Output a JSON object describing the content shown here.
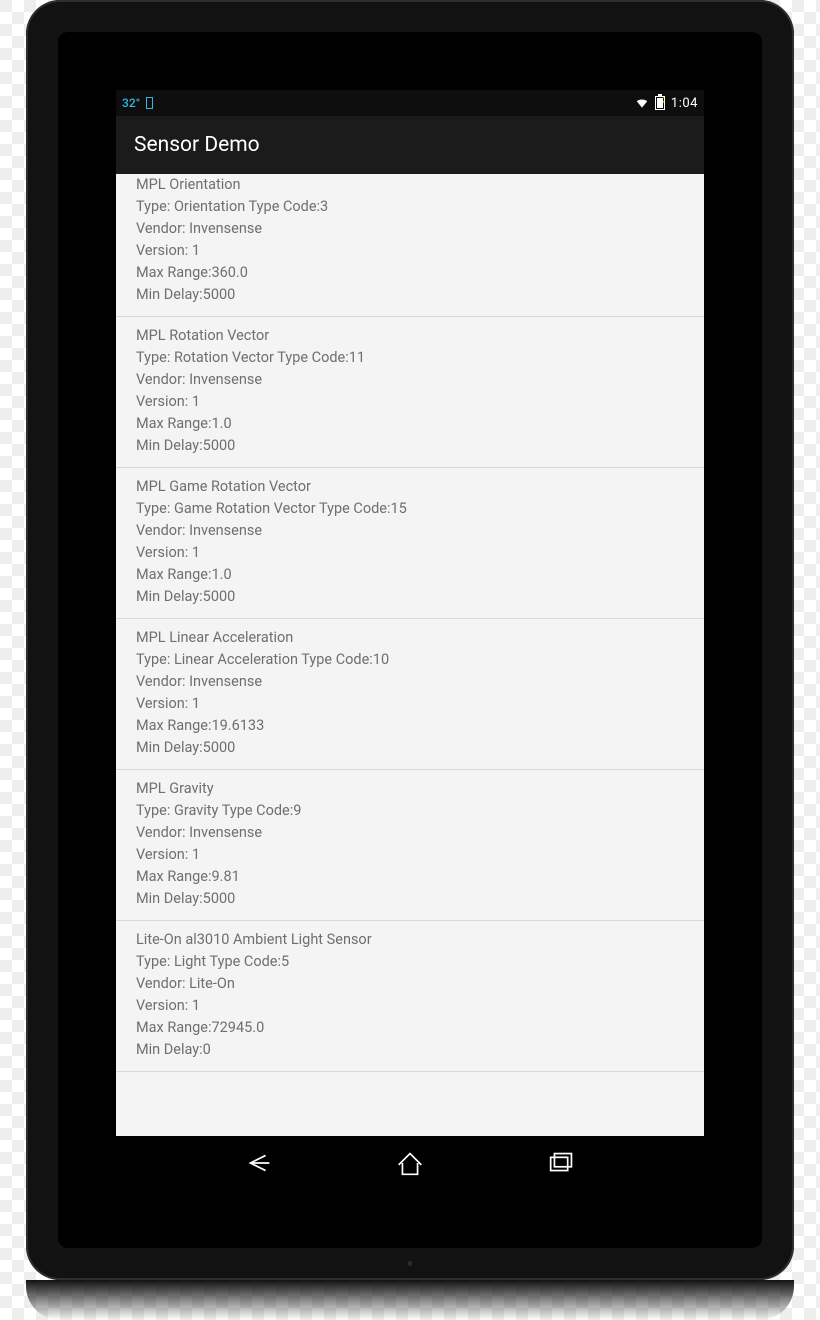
{
  "status": {
    "temp": "32°",
    "time": "1:04"
  },
  "actionbar": {
    "title": "Sensor Demo"
  },
  "labels": {
    "type_prefix": "Type: ",
    "type_code_mid": " Type Code:",
    "vendor_prefix": "Vendor: ",
    "version_prefix": "Version: ",
    "maxrange_prefix": "Max Range:",
    "mindelay_prefix": "Min Delay:"
  },
  "sensors": [
    {
      "name": "MPL Orientation",
      "type": "Orientation",
      "code": "3",
      "vendor": "Invensense",
      "version": "1",
      "max_range": "360.0",
      "min_delay": "5000",
      "truncated_top": true
    },
    {
      "name": "MPL Rotation Vector",
      "type": "Rotation Vector",
      "code": "11",
      "vendor": "Invensense",
      "version": "1",
      "max_range": "1.0",
      "min_delay": "5000"
    },
    {
      "name": "MPL Game Rotation Vector",
      "type": "Game Rotation Vector",
      "code": "15",
      "vendor": "Invensense",
      "version": "1",
      "max_range": "1.0",
      "min_delay": "5000"
    },
    {
      "name": "MPL Linear Acceleration",
      "type": "Linear Acceleration",
      "code": "10",
      "vendor": "Invensense",
      "version": "1",
      "max_range": "19.6133",
      "min_delay": "5000"
    },
    {
      "name": "MPL Gravity",
      "type": "Gravity",
      "code": "9",
      "vendor": "Invensense",
      "version": "1",
      "max_range": "9.81",
      "min_delay": "5000"
    },
    {
      "name": "Lite-On al3010 Ambient Light Sensor",
      "type": "Light",
      "code": "5",
      "vendor": "Lite-On",
      "version": "1",
      "max_range": "72945.0",
      "min_delay": "0"
    }
  ]
}
